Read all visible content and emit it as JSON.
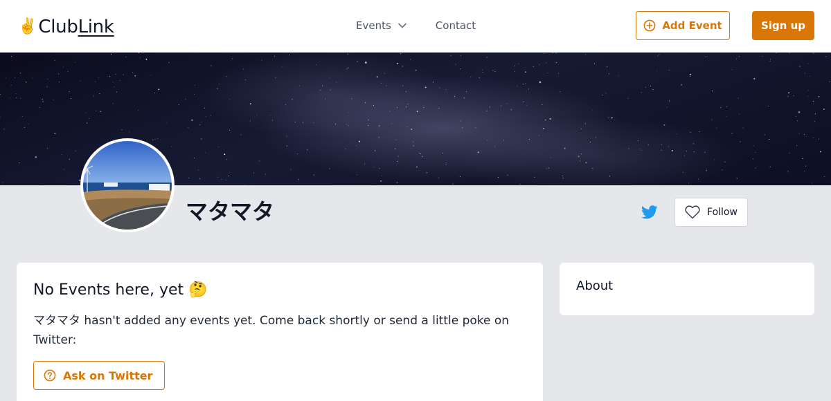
{
  "app": {
    "logo_emoji": "✌️",
    "logo_prefix": "Club",
    "logo_suffix": "Link"
  },
  "nav": {
    "events_label": "Events",
    "contact_label": "Contact"
  },
  "header_actions": {
    "add_event_label": "Add Event",
    "signup_label": "Sign up"
  },
  "profile": {
    "name": "マタマタ",
    "follow_label": "Follow"
  },
  "events_card": {
    "title": "No Events here, yet",
    "title_emoji": "🤔",
    "message": "マタマタ hasn't added any events yet. Come back shortly or send a little poke on Twitter:",
    "ask_button_label": "Ask on Twitter"
  },
  "about_card": {
    "title": "About"
  },
  "colors": {
    "accent": "#d97706",
    "twitter": "#1d9bf0",
    "page_bg": "#e5e7eb"
  }
}
